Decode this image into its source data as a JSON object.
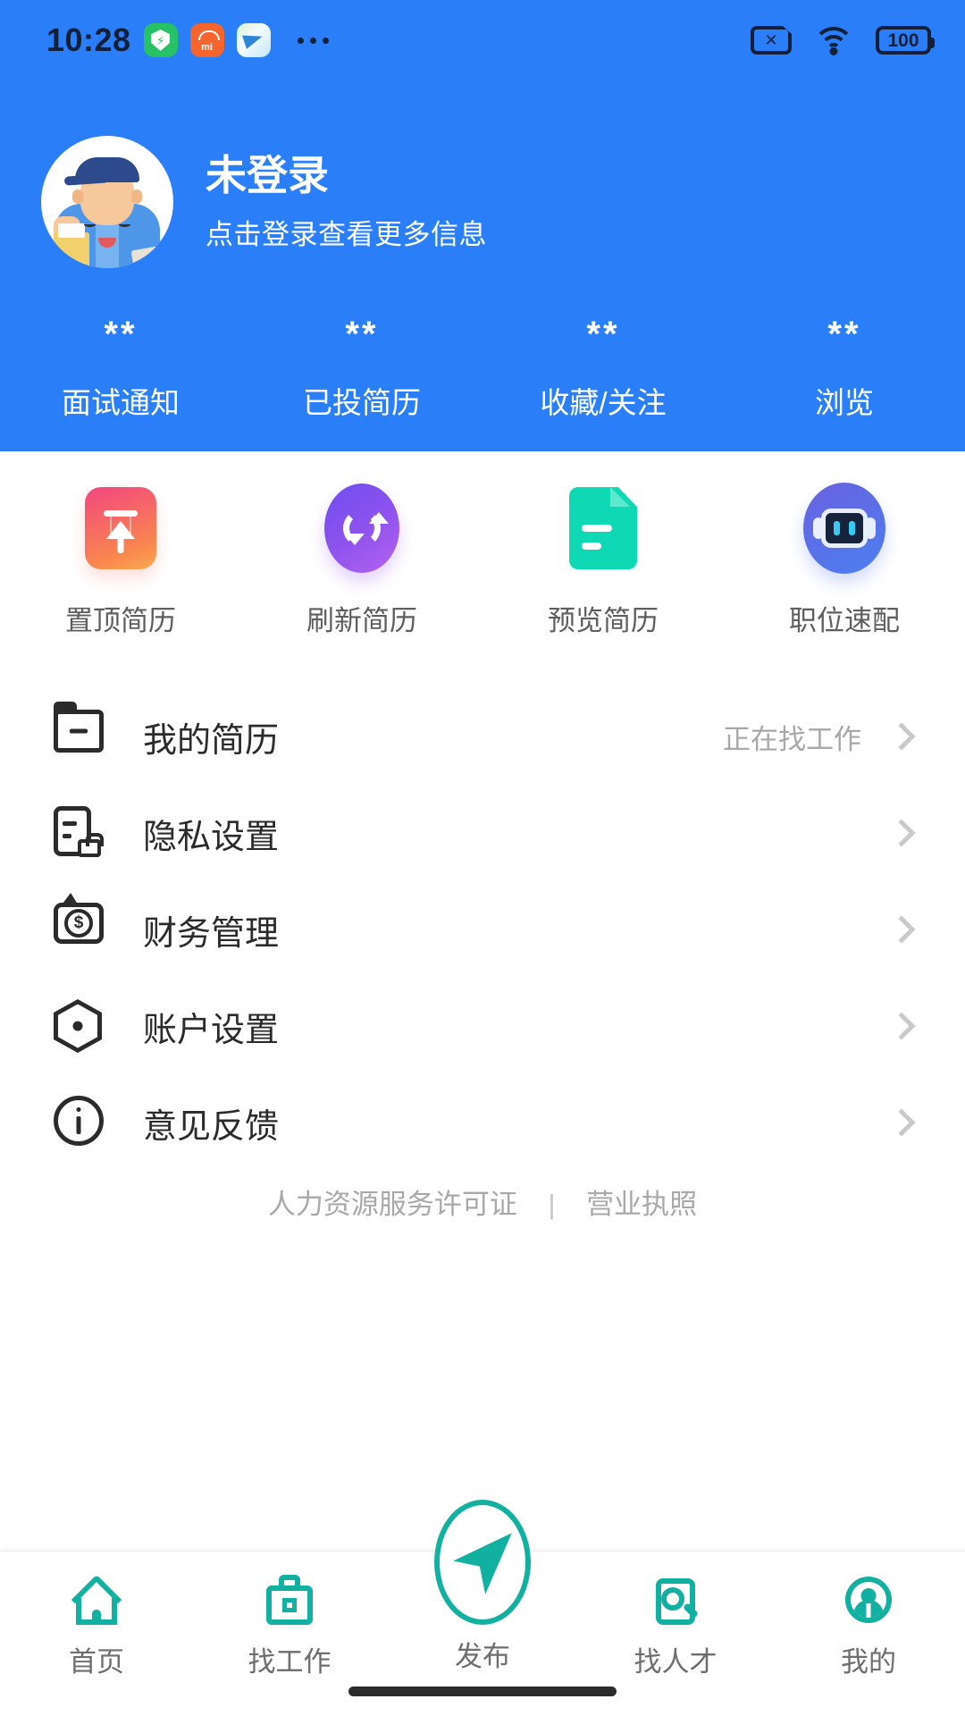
{
  "status_bar": {
    "time": "10:28",
    "app_icons": [
      "shield-icon",
      "mi-store-icon",
      "telegram-icon"
    ],
    "overflow": "more-icon",
    "sim_icon": "sim-card-off-icon",
    "wifi_icon": "wifi-icon",
    "battery_level": "100"
  },
  "header": {
    "background_color": "#2a7ef7",
    "avatar_name": "worker-avatar",
    "title": "未登录",
    "subtitle": "点击登录查看更多信息",
    "stats": [
      {
        "value": "**",
        "label": "面试通知"
      },
      {
        "value": "**",
        "label": "已投简历"
      },
      {
        "value": "**",
        "label": "收藏/关注"
      },
      {
        "value": "**",
        "label": "浏览"
      }
    ]
  },
  "quick_actions": [
    {
      "label": "置顶简历",
      "icon": "top-resume-icon",
      "color": "#f76a55"
    },
    {
      "label": "刷新简历",
      "icon": "refresh-resume-icon",
      "color": "#8d52ee"
    },
    {
      "label": "预览简历",
      "icon": "preview-resume-icon",
      "color": "#0fd9b4"
    },
    {
      "label": "职位速配",
      "icon": "job-match-robot-icon",
      "color": "#4a7ff0"
    }
  ],
  "menu": [
    {
      "label": "我的简历",
      "icon": "folder-icon",
      "value": "正在找工作"
    },
    {
      "label": "隐私设置",
      "icon": "privacy-lock-icon",
      "value": ""
    },
    {
      "label": "财务管理",
      "icon": "wallet-icon",
      "value": ""
    },
    {
      "label": "账户设置",
      "icon": "account-hexagon-icon",
      "value": ""
    },
    {
      "label": "意见反馈",
      "icon": "info-circle-icon",
      "value": ""
    }
  ],
  "footer_links": {
    "left": "人力资源服务许可证",
    "separator": "|",
    "right": "营业执照"
  },
  "tabbar": {
    "accent_color": "#12b0a0",
    "items": [
      {
        "label": "首页",
        "icon": "home-icon"
      },
      {
        "label": "找工作",
        "icon": "briefcase-icon"
      },
      {
        "label": "发布",
        "icon": "publish-send-icon"
      },
      {
        "label": "找人才",
        "icon": "search-person-icon"
      },
      {
        "label": "我的",
        "icon": "profile-icon"
      }
    ]
  }
}
